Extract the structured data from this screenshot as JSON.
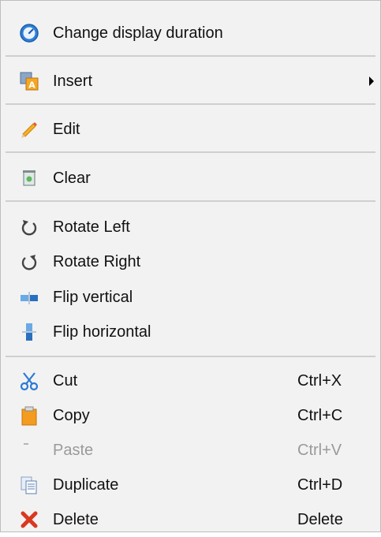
{
  "menu": {
    "items": [
      {
        "label": "Change display duration",
        "icon": "stopwatch-icon"
      },
      {
        "label": "Insert",
        "icon": "insert-icon",
        "submenu": true
      },
      {
        "label": "Edit",
        "icon": "pencil-icon"
      },
      {
        "label": "Clear",
        "icon": "clear-icon"
      },
      {
        "label": "Rotate Left",
        "icon": "rotate-left-icon"
      },
      {
        "label": "Rotate Right",
        "icon": "rotate-right-icon"
      },
      {
        "label": "Flip vertical",
        "icon": "flip-vertical-icon"
      },
      {
        "label": "Flip horizontal",
        "icon": "flip-horizontal-icon"
      },
      {
        "label": "Cut",
        "shortcut": "Ctrl+X",
        "icon": "scissors-icon"
      },
      {
        "label": "Copy",
        "shortcut": "Ctrl+C",
        "icon": "copy-icon"
      },
      {
        "label": "Paste",
        "shortcut": "Ctrl+V",
        "icon": "paste-icon",
        "disabled": true
      },
      {
        "label": "Duplicate",
        "shortcut": "Ctrl+D",
        "icon": "duplicate-icon"
      },
      {
        "label": "Delete",
        "shortcut": "Delete",
        "icon": "delete-icon"
      }
    ]
  },
  "colors": {
    "background": "#f2f2f2",
    "separator": "#cfcfcf",
    "disabled_text": "#9a9a9a",
    "delete_red": "#d9381e",
    "copy_orange": "#f39c1f",
    "cut_blue": "#2a7ad6"
  }
}
